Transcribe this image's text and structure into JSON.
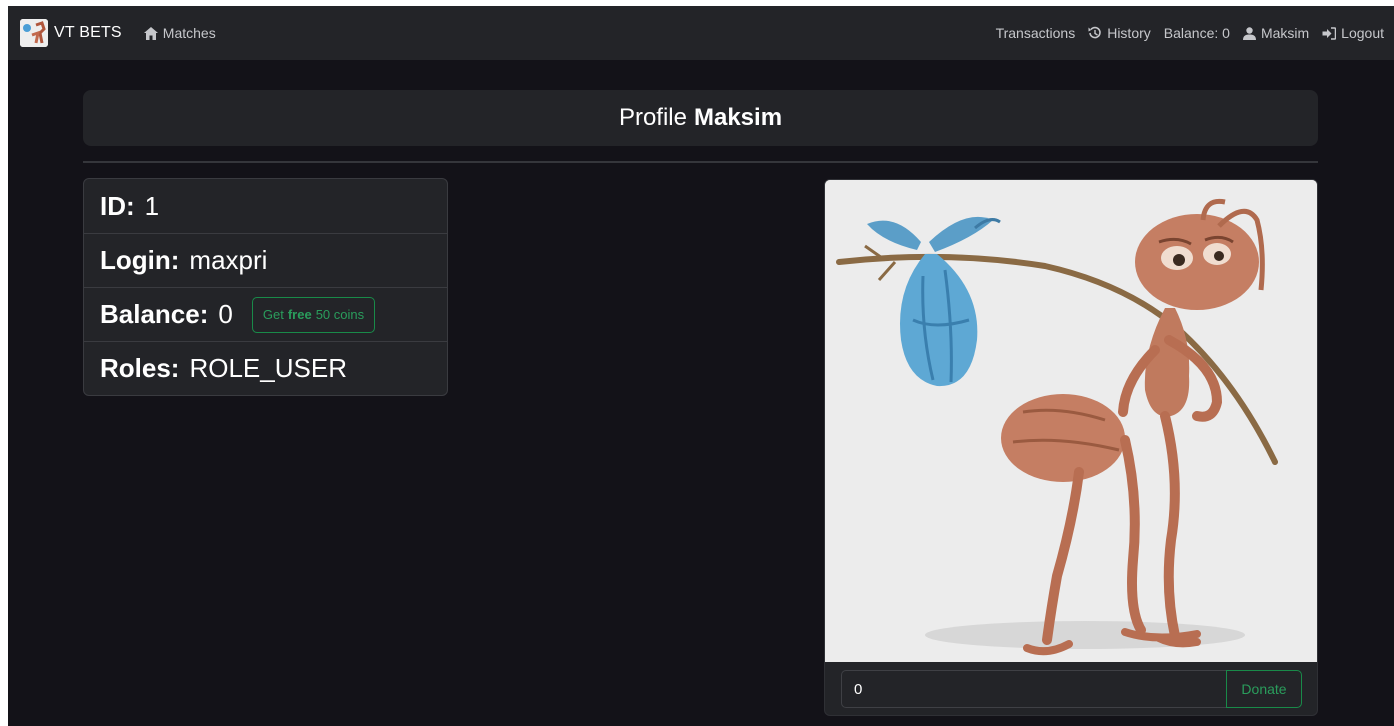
{
  "navbar": {
    "brand": "VT BETS",
    "matches": "Matches",
    "transactions": "Transactions",
    "history": "History",
    "balance": "Balance: 0",
    "user": "Maksim",
    "logout": "Logout"
  },
  "header": {
    "prefix": "Profile",
    "username": "Maksim"
  },
  "profile": {
    "id_label": "ID:",
    "id_value": "1",
    "login_label": "Login:",
    "login_value": "maxpri",
    "balance_label": "Balance:",
    "balance_value": "0",
    "free_button": {
      "pre": "Get",
      "bold": "free",
      "post": "50 coins"
    },
    "roles_label": "Roles:",
    "roles_value": "ROLE_USER"
  },
  "donate": {
    "input_value": "0",
    "button": "Donate"
  },
  "icons": {
    "matches": "home-icon",
    "history": "history-icon",
    "user": "user-icon",
    "logout": "logout-icon"
  },
  "colors": {
    "background": "#131218",
    "panel": "#232428",
    "success": "#198a49"
  }
}
